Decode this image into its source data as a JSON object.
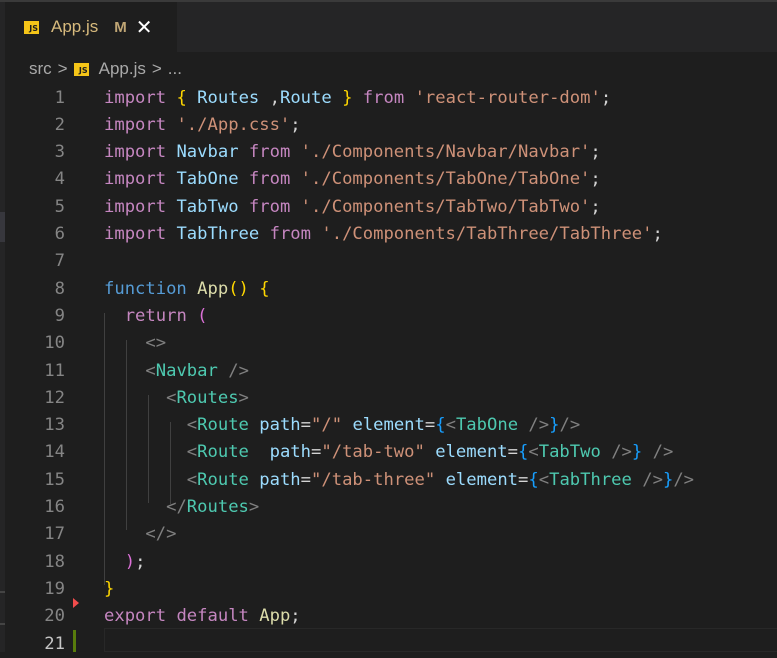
{
  "tab": {
    "icon": "js-file-icon",
    "icon_text": "JS",
    "title": "App.js",
    "status": "M",
    "close_glyph": "✕"
  },
  "breadcrumb": {
    "folder": "src",
    "sep": ">",
    "file": "App.js",
    "more": "..."
  },
  "editor": {
    "current_line": 21,
    "lines": [
      {
        "n": "1",
        "tokens": [
          [
            "kw",
            "import"
          ],
          [
            "plain",
            " "
          ],
          [
            "br1",
            "{"
          ],
          [
            "plain",
            " "
          ],
          [
            "var",
            "Routes"
          ],
          [
            "plain",
            " ,"
          ],
          [
            "var",
            "Route"
          ],
          [
            "plain",
            " "
          ],
          [
            "br1",
            "}"
          ],
          [
            "plain",
            " "
          ],
          [
            "kw",
            "from"
          ],
          [
            "plain",
            " "
          ],
          [
            "str",
            "'react-router-dom'"
          ],
          [
            "plain",
            ";"
          ]
        ]
      },
      {
        "n": "2",
        "tokens": [
          [
            "kw",
            "import"
          ],
          [
            "plain",
            " "
          ],
          [
            "str",
            "'./App.css'"
          ],
          [
            "plain",
            ";"
          ]
        ]
      },
      {
        "n": "3",
        "tokens": [
          [
            "kw",
            "import"
          ],
          [
            "plain",
            " "
          ],
          [
            "var",
            "Navbar"
          ],
          [
            "plain",
            " "
          ],
          [
            "kw",
            "from"
          ],
          [
            "plain",
            " "
          ],
          [
            "str",
            "'./Components/Navbar/Navbar'"
          ],
          [
            "plain",
            ";"
          ]
        ]
      },
      {
        "n": "4",
        "tokens": [
          [
            "kw",
            "import"
          ],
          [
            "plain",
            " "
          ],
          [
            "var",
            "TabOne"
          ],
          [
            "plain",
            " "
          ],
          [
            "kw",
            "from"
          ],
          [
            "plain",
            " "
          ],
          [
            "str",
            "'./Components/TabOne/TabOne'"
          ],
          [
            "plain",
            ";"
          ]
        ]
      },
      {
        "n": "5",
        "tokens": [
          [
            "kw",
            "import"
          ],
          [
            "plain",
            " "
          ],
          [
            "var",
            "TabTwo"
          ],
          [
            "plain",
            " "
          ],
          [
            "kw",
            "from"
          ],
          [
            "plain",
            " "
          ],
          [
            "str",
            "'./Components/TabTwo/TabTwo'"
          ],
          [
            "plain",
            ";"
          ]
        ]
      },
      {
        "n": "6",
        "tokens": [
          [
            "kw",
            "import"
          ],
          [
            "plain",
            " "
          ],
          [
            "var",
            "TabThree"
          ],
          [
            "plain",
            " "
          ],
          [
            "kw",
            "from"
          ],
          [
            "plain",
            " "
          ],
          [
            "str",
            "'./Components/TabThree/TabThree'"
          ],
          [
            "plain",
            ";"
          ]
        ]
      },
      {
        "n": "7",
        "tokens": []
      },
      {
        "n": "8",
        "tokens": [
          [
            "kw2",
            "function"
          ],
          [
            "plain",
            " "
          ],
          [
            "fn",
            "App"
          ],
          [
            "br1",
            "()"
          ],
          [
            "plain",
            " "
          ],
          [
            "br1",
            "{"
          ]
        ]
      },
      {
        "n": "9",
        "tokens": [
          [
            "plain",
            "  "
          ],
          [
            "kw",
            "return"
          ],
          [
            "plain",
            " "
          ],
          [
            "br2",
            "("
          ]
        ]
      },
      {
        "n": "10",
        "tokens": [
          [
            "plain",
            "    "
          ],
          [
            "punc",
            "<>"
          ]
        ]
      },
      {
        "n": "11",
        "tokens": [
          [
            "plain",
            "    "
          ],
          [
            "punc",
            "<"
          ],
          [
            "tag",
            "Navbar"
          ],
          [
            "plain",
            " "
          ],
          [
            "punc",
            "/>"
          ]
        ]
      },
      {
        "n": "12",
        "tokens": [
          [
            "plain",
            "      "
          ],
          [
            "punc",
            "<"
          ],
          [
            "tag",
            "Routes"
          ],
          [
            "punc",
            ">"
          ]
        ]
      },
      {
        "n": "13",
        "tokens": [
          [
            "plain",
            "        "
          ],
          [
            "punc",
            "<"
          ],
          [
            "tag",
            "Route"
          ],
          [
            "plain",
            " "
          ],
          [
            "var",
            "path"
          ],
          [
            "plain",
            "="
          ],
          [
            "str",
            "\"/\""
          ],
          [
            "plain",
            " "
          ],
          [
            "var",
            "element"
          ],
          [
            "plain",
            "="
          ],
          [
            "br3",
            "{"
          ],
          [
            "punc",
            "<"
          ],
          [
            "tag",
            "TabOne"
          ],
          [
            "plain",
            " "
          ],
          [
            "punc",
            "/>"
          ],
          [
            "br3",
            "}"
          ],
          [
            "punc",
            "/>"
          ]
        ]
      },
      {
        "n": "14",
        "tokens": [
          [
            "plain",
            "        "
          ],
          [
            "punc",
            "<"
          ],
          [
            "tag",
            "Route"
          ],
          [
            "plain",
            "  "
          ],
          [
            "var",
            "path"
          ],
          [
            "plain",
            "="
          ],
          [
            "str",
            "\"/tab-two\""
          ],
          [
            "plain",
            " "
          ],
          [
            "var",
            "element"
          ],
          [
            "plain",
            "="
          ],
          [
            "br3",
            "{"
          ],
          [
            "punc",
            "<"
          ],
          [
            "tag",
            "TabTwo"
          ],
          [
            "plain",
            " "
          ],
          [
            "punc",
            "/>"
          ],
          [
            "br3",
            "}"
          ],
          [
            "plain",
            " "
          ],
          [
            "punc",
            "/>"
          ]
        ]
      },
      {
        "n": "15",
        "tokens": [
          [
            "plain",
            "        "
          ],
          [
            "punc",
            "<"
          ],
          [
            "tag",
            "Route"
          ],
          [
            "plain",
            " "
          ],
          [
            "var",
            "path"
          ],
          [
            "plain",
            "="
          ],
          [
            "str",
            "\"/tab-three\""
          ],
          [
            "plain",
            " "
          ],
          [
            "var",
            "element"
          ],
          [
            "plain",
            "="
          ],
          [
            "br3",
            "{"
          ],
          [
            "punc",
            "<"
          ],
          [
            "tag",
            "TabThree"
          ],
          [
            "plain",
            " "
          ],
          [
            "punc",
            "/>"
          ],
          [
            "br3",
            "}"
          ],
          [
            "punc",
            "/>"
          ]
        ]
      },
      {
        "n": "16",
        "tokens": [
          [
            "plain",
            "      "
          ],
          [
            "punc",
            "</"
          ],
          [
            "tag",
            "Routes"
          ],
          [
            "punc",
            ">"
          ]
        ]
      },
      {
        "n": "17",
        "tokens": [
          [
            "plain",
            "    "
          ],
          [
            "punc",
            "</>"
          ]
        ]
      },
      {
        "n": "18",
        "tokens": [
          [
            "plain",
            "  "
          ],
          [
            "br2",
            ")"
          ],
          [
            "plain",
            ";"
          ]
        ]
      },
      {
        "n": "19",
        "tokens": [
          [
            "br1",
            "}"
          ]
        ]
      },
      {
        "n": "20",
        "tokens": [
          [
            "kw",
            "export"
          ],
          [
            "plain",
            " "
          ],
          [
            "kw",
            "default"
          ],
          [
            "plain",
            " "
          ],
          [
            "fn",
            "App"
          ],
          [
            "plain",
            ";"
          ]
        ]
      },
      {
        "n": "21",
        "tokens": []
      }
    ]
  }
}
